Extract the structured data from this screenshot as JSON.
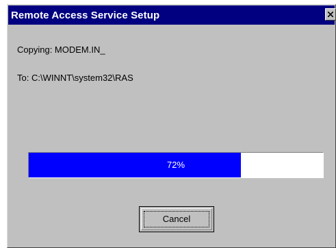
{
  "window": {
    "title": "Remote Access Service Setup",
    "close_icon": "close-icon"
  },
  "status": {
    "copying_text": "Copying: MODEM.IN_",
    "destination_text": "To: C:\\WINNT\\system32\\RAS"
  },
  "progress": {
    "percent": 72,
    "label": "72%",
    "fill_color": "#0000ff"
  },
  "buttons": {
    "cancel_label": "Cancel"
  },
  "colors": {
    "title_bar": "#000080",
    "dialog_face": "#c0c0c0"
  }
}
